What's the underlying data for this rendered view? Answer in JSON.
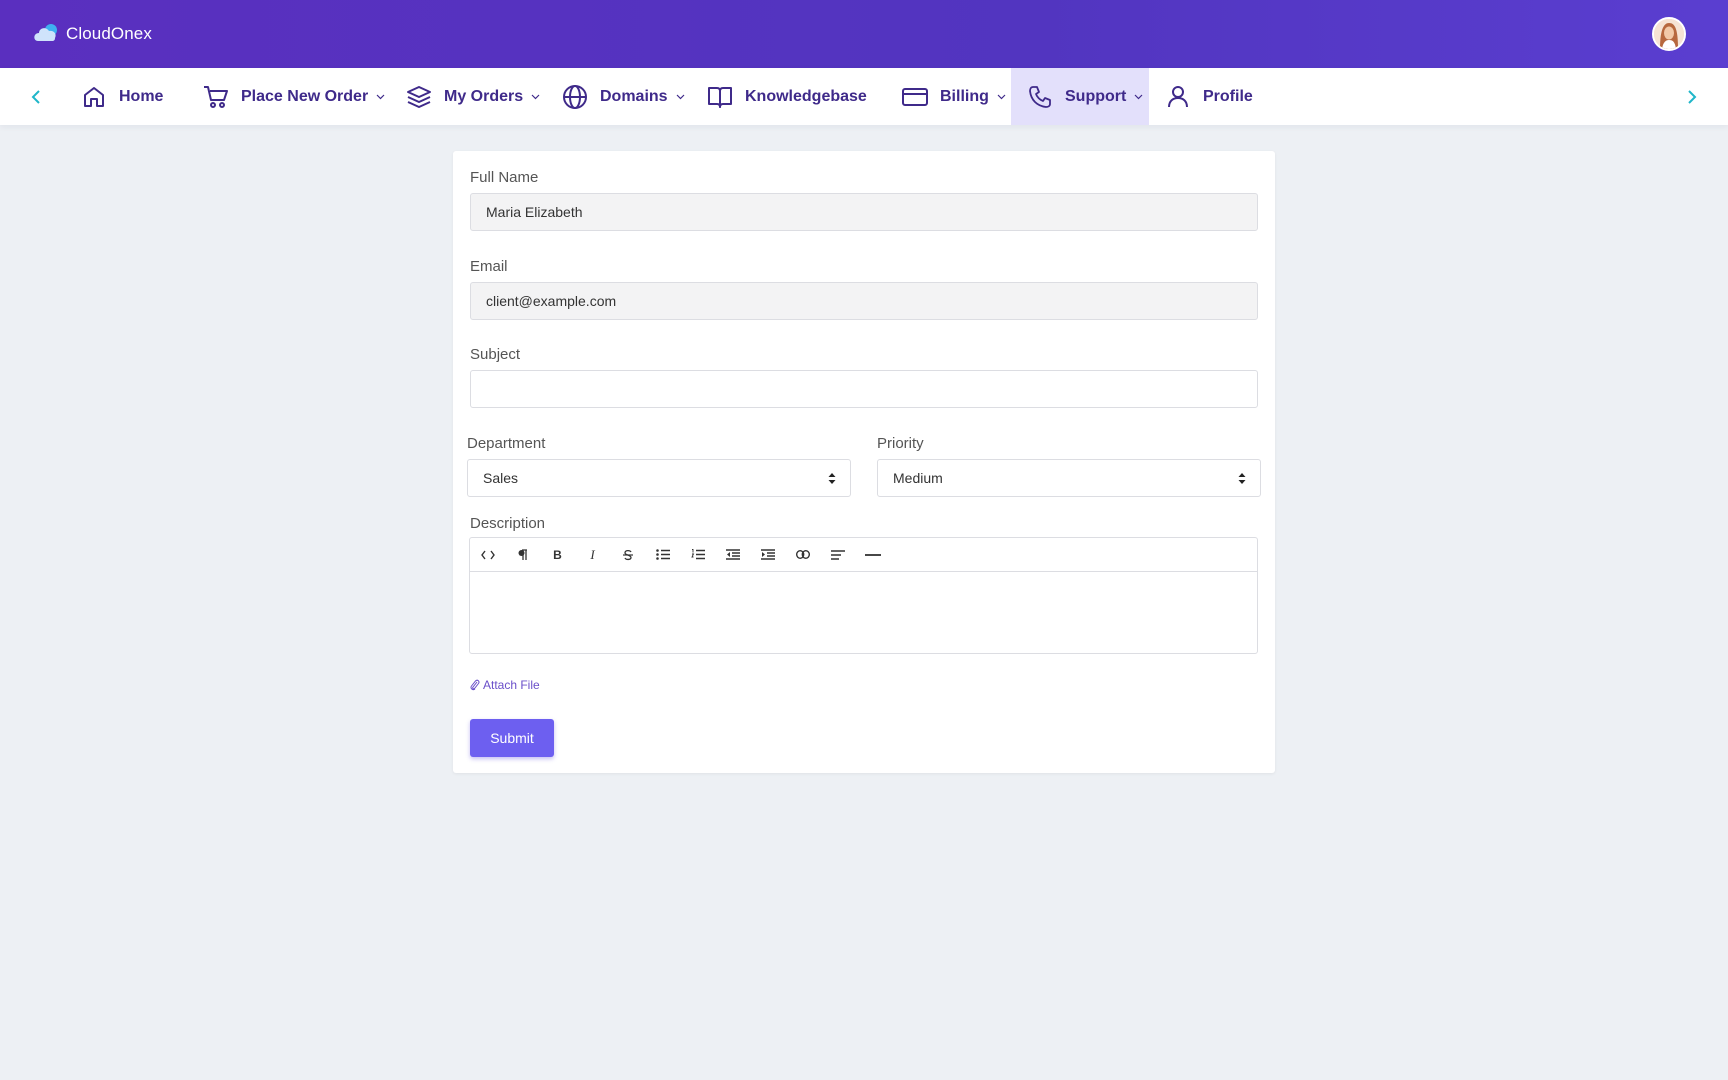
{
  "brand": {
    "name": "CloudOnex",
    "logo_icon": "cloud-icon"
  },
  "nav": {
    "items": [
      {
        "label": "Home",
        "icon": "home-icon"
      },
      {
        "label": "Place New Order",
        "icon": "cart-icon",
        "dropdown": true
      },
      {
        "label": "My Orders",
        "icon": "layers-icon",
        "dropdown": true
      },
      {
        "label": "Domains",
        "icon": "globe-icon",
        "dropdown": true
      },
      {
        "label": "Knowledgebase",
        "icon": "book-icon"
      },
      {
        "label": "Billing",
        "icon": "credit-card-icon",
        "dropdown": true
      },
      {
        "label": "Support",
        "icon": "phone-icon",
        "dropdown": true,
        "active": true
      },
      {
        "label": "Profile",
        "icon": "user-icon"
      }
    ]
  },
  "form": {
    "full_name": {
      "label": "Full Name",
      "value": "Maria Elizabeth"
    },
    "email": {
      "label": "Email",
      "value": "client@example.com"
    },
    "subject": {
      "label": "Subject",
      "value": ""
    },
    "department": {
      "label": "Department",
      "value": "Sales"
    },
    "priority": {
      "label": "Priority",
      "value": "Medium"
    },
    "description": {
      "label": "Description",
      "toolbar": [
        "code-view-icon",
        "paragraph-icon",
        "bold-icon",
        "italic-icon",
        "strikethrough-icon",
        "bullet-list-icon",
        "numbered-list-icon",
        "outdent-icon",
        "indent-icon",
        "link-icon",
        "align-left-icon",
        "horizontal-rule-icon"
      ]
    },
    "attach_label": "Attach File",
    "submit_label": "Submit"
  },
  "colors": {
    "topbar": "#5532c0",
    "nav_text": "#3f2a8a",
    "nav_active_bg": "#e3e0fb",
    "accent_arrow": "#1fb6c9",
    "submit_bg": "#6d5ff0",
    "page_bg": "#edf0f4"
  }
}
